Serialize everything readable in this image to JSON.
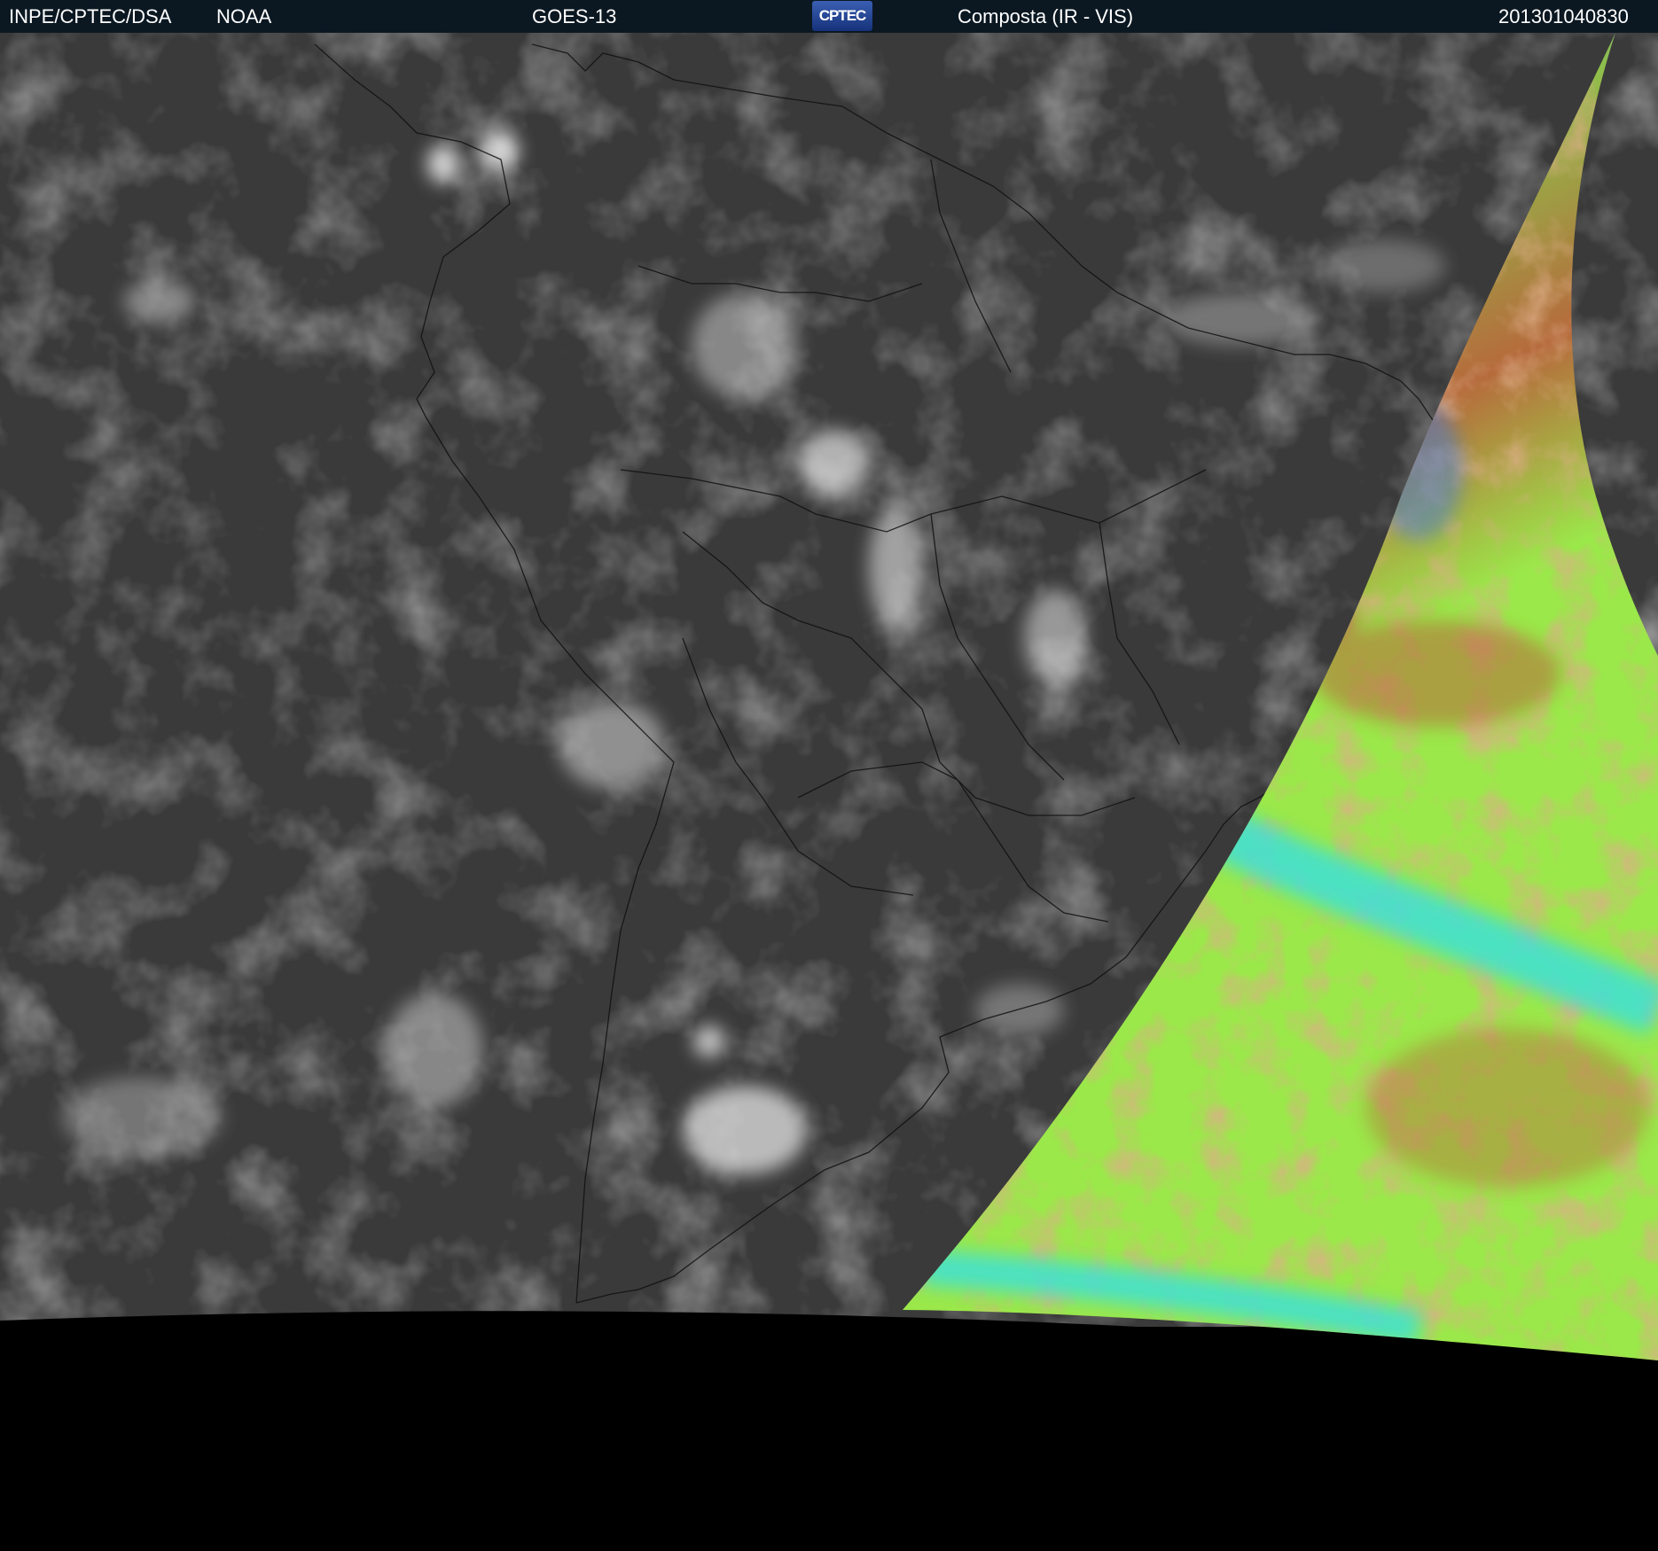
{
  "header": {
    "institution": "INPE/CPTEC/DSA",
    "agency": "NOAA",
    "satellite": "GOES-13",
    "logo_text": "CPTEC",
    "product": "Composta (IR - VIS)",
    "timestamp": "201301040830"
  },
  "colors": {
    "header_bg": "#0b1822",
    "ir_gray": "#3a3a3a",
    "vis_green": "#9be84a",
    "vis_orange": "#b66a3c",
    "vis_cyan": "#37e0e0",
    "vis_blue": "#3a7ae0",
    "space": "#000000"
  }
}
